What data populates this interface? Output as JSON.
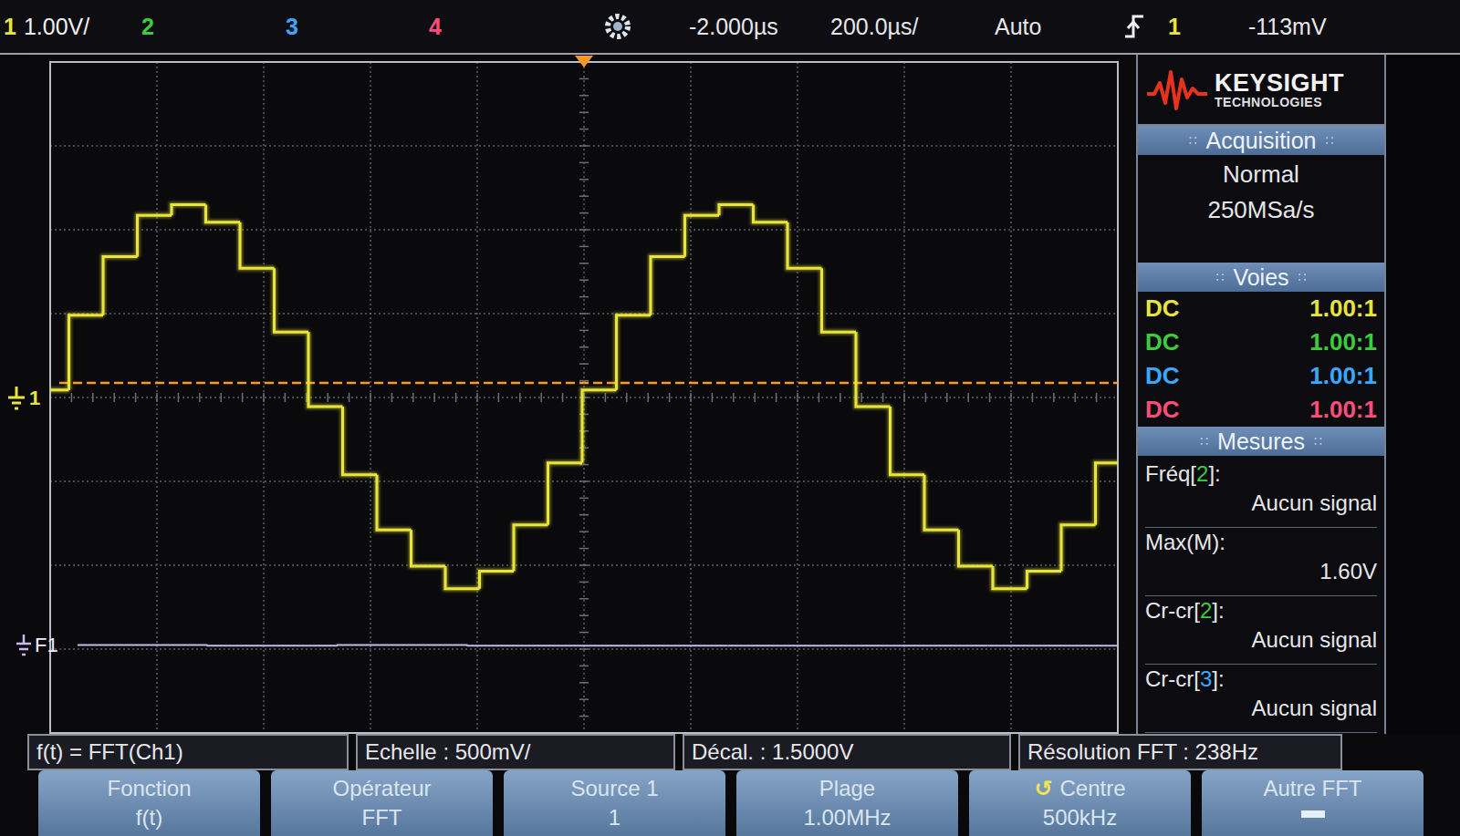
{
  "top_bar": {
    "ch1_label": "1",
    "ch1_scale": "1.00V/",
    "ch1_color": "#e8e43a",
    "other_channels": [
      {
        "label": "2",
        "color": "#3ccc3c"
      },
      {
        "label": "3",
        "color": "#3aa8ff"
      },
      {
        "label": "4",
        "color": "#ff4d7a"
      }
    ],
    "delay": "-2.000µs",
    "timebase": "200.0µs/",
    "trigger_mode": "Auto",
    "trigger_source": "1",
    "trigger_level": "-113mV"
  },
  "chart": {
    "ch1_marker": "1",
    "math_marker": "F1",
    "ch1_trace": {
      "color": "#e8e43a",
      "values": [
        0.09,
        0.98,
        1.68,
        2.17,
        2.3,
        2.09,
        1.54,
        0.78,
        -0.11,
        -0.92,
        -1.58,
        -2.01,
        -2.28,
        -2.07,
        -1.52,
        -0.78,
        0.09,
        0.98,
        1.68,
        2.17,
        2.3,
        2.09,
        1.54,
        0.78,
        -0.11,
        -0.92,
        -1.58,
        -2.01,
        -2.28,
        -2.07,
        -1.52,
        -0.78
      ]
    },
    "math_trace": {
      "color": "#c8b8ec",
      "values": [
        -2.95,
        -2.96,
        -2.95,
        -2.96,
        -2.96,
        -2.96,
        -2.96,
        -2.96
      ]
    }
  },
  "panel": {
    "logo": {
      "brand": "KEYSIGHT",
      "sub": "TECHNOLOGIES"
    },
    "acquisition": {
      "title": "Acquisition",
      "mode": "Normal",
      "rate": "250MSa/s"
    },
    "channels": {
      "title": "Voies",
      "items": [
        {
          "coupling": "DC",
          "probe": "1.00:1",
          "color": "#e8e43a"
        },
        {
          "coupling": "DC",
          "probe": "1.00:1",
          "color": "#3ccc3c"
        },
        {
          "coupling": "DC",
          "probe": "1.00:1",
          "color": "#3aa8ff"
        },
        {
          "coupling": "DC",
          "probe": "1.00:1",
          "color": "#ff4d7a"
        }
      ]
    },
    "measurements": {
      "title": "Mesures",
      "items": [
        {
          "pre": "Fréq[",
          "ch": "2",
          "post": "]:",
          "color": "#3ccc3c",
          "value": "Aucun signal"
        },
        {
          "pre": "Max(M):",
          "value": "1.60V"
        },
        {
          "pre": "Cr-cr[",
          "ch": "2",
          "post": "]:",
          "color": "#3ccc3c",
          "value": "Aucun signal"
        },
        {
          "pre": "Cr-cr[",
          "ch": "3",
          "post": "]:",
          "color": "#3aa8ff",
          "value": "Aucun signal"
        }
      ]
    }
  },
  "info": [
    "f(t) = FFT(Ch1)",
    "Echelle : 500mV/",
    "Décal. : 1.5000V",
    "Résolution FFT : 238Hz"
  ],
  "softkeys": [
    {
      "label": "Fonction",
      "value": "f(t)"
    },
    {
      "label": "Opérateur",
      "value": "FFT"
    },
    {
      "label": "Source 1",
      "value": "1"
    },
    {
      "label": "Plage",
      "value": "1.00MHz"
    },
    {
      "label": "Centre",
      "value": "500kHz",
      "icon": "↺"
    },
    {
      "label": "Autre FFT"
    }
  ]
}
